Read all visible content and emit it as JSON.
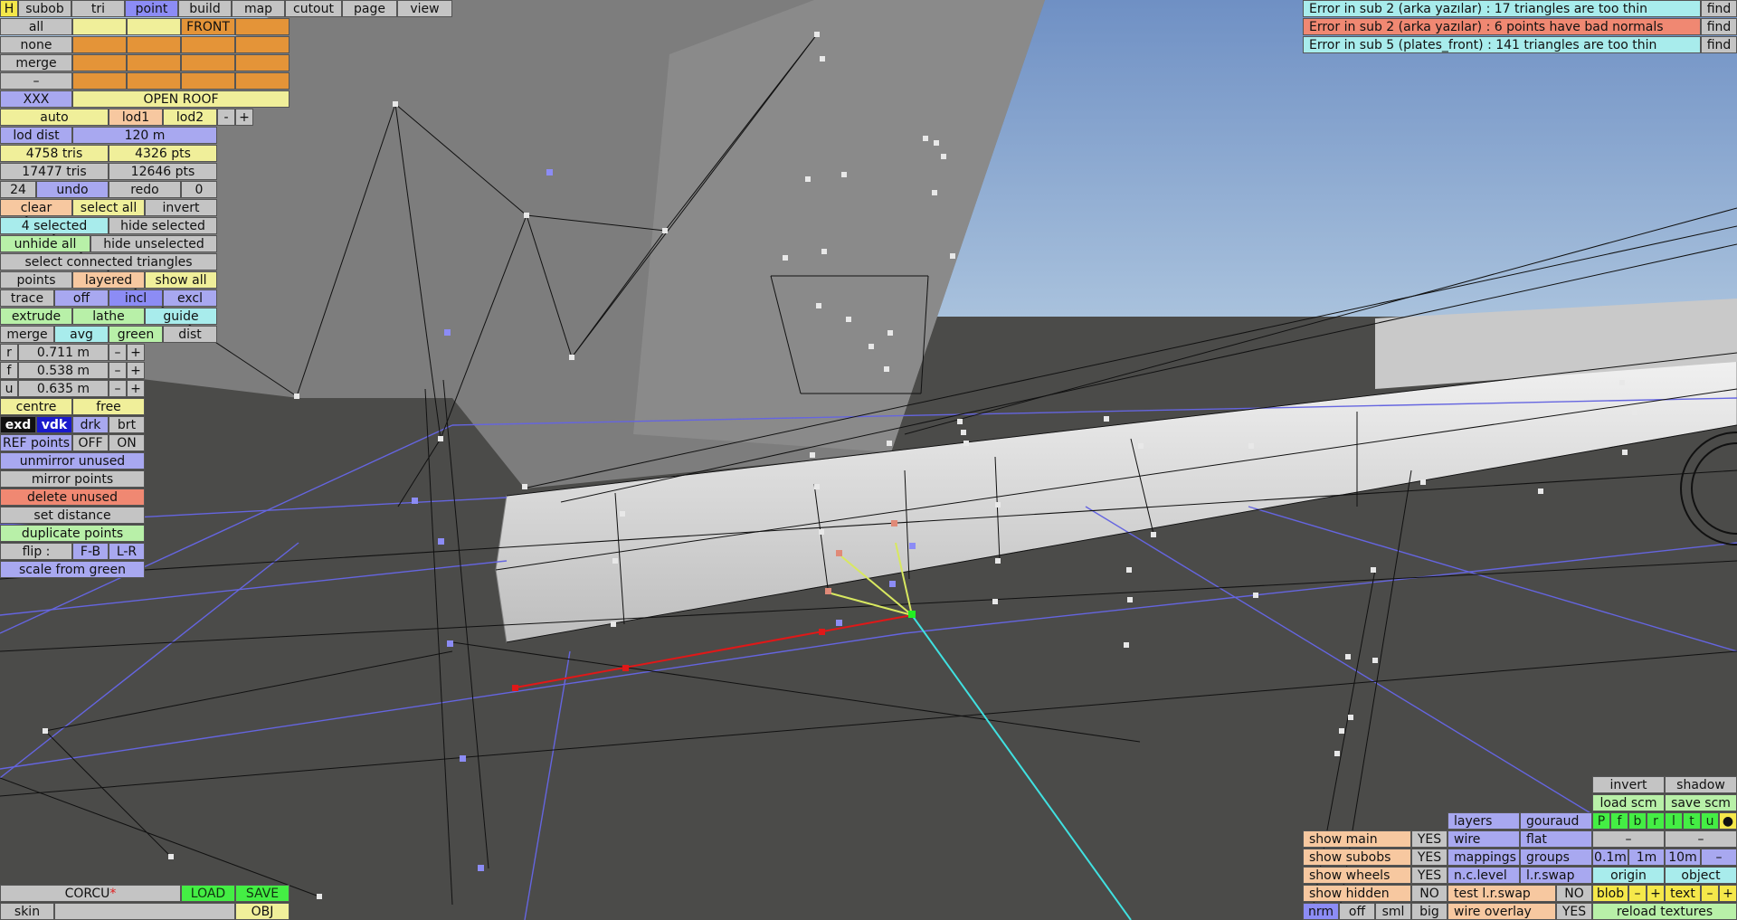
{
  "top_menu": [
    "H",
    "subob",
    "tri",
    "point",
    "build",
    "map",
    "cutout",
    "page",
    "view"
  ],
  "selection_rows": [
    "all",
    "none",
    "merge",
    "–"
  ],
  "front_label": "FRONT",
  "xxx_label": "XXX",
  "open_roof_label": "OPEN ROOF",
  "lod": {
    "auto": "auto",
    "lod1": "lod1",
    "lod2": "lod2",
    "minus": "-",
    "plus": "+",
    "dist_label": "lod dist",
    "dist_value": "120 m"
  },
  "stats": {
    "tris_a": "4758 tris",
    "pts_a": "4326 pts",
    "tris_b": "17477 tris",
    "pts_b": "12646 pts"
  },
  "undo": {
    "count": "24",
    "undo": "undo",
    "redo": "redo",
    "redo_count": "0"
  },
  "actions": {
    "clear": "clear",
    "select_all": "select all",
    "invert": "invert",
    "selected": "4 selected",
    "hide_selected": "hide selected",
    "unhide_all": "unhide all",
    "hide_unselected": "hide unselected",
    "select_connected": "select connected triangles"
  },
  "points_row": {
    "points": "points",
    "layered": "layered",
    "show_all": "show all"
  },
  "trace_row": {
    "trace": "trace",
    "off": "off",
    "incl": "incl",
    "excl": "excl"
  },
  "tools_row": {
    "extrude": "extrude",
    "lathe": "lathe",
    "guide": "guide"
  },
  "merge_row": {
    "merge": "merge",
    "avg": "avg",
    "green": "green",
    "dist": "dist"
  },
  "params": [
    {
      "label": "r",
      "value": "0.711 m"
    },
    {
      "label": "f",
      "value": "0.538 m"
    },
    {
      "label": "u",
      "value": "0.635 m"
    }
  ],
  "pm": {
    "minus": "–",
    "plus": "+"
  },
  "centre_row": {
    "centre": "centre",
    "free": "free"
  },
  "shade_row": {
    "exd": "exd",
    "vdk": "vdk",
    "drk": "drk",
    "brt": "brt"
  },
  "ref_row": {
    "label": "REF points",
    "off": "OFF",
    "on": "ON"
  },
  "bottom_actions": {
    "unmirror": "unmirror unused",
    "mirror": "mirror points",
    "delete": "delete unused",
    "set_distance": "set distance",
    "duplicate": "duplicate points",
    "flip": "flip :",
    "fb": "F-B",
    "lr": "L-R",
    "scale": "scale from green"
  },
  "errors": [
    {
      "text": "Error in sub 2 (arka yazılar) : 17 triangles are too thin",
      "color": "#a8ecec",
      "find": "find"
    },
    {
      "text": "Error in sub 2 (arka yazılar) : 6 points have bad normals",
      "color": "#f08872",
      "find": "find"
    },
    {
      "text": "Error in sub 5 (plates_front) : 141 triangles are too thin",
      "color": "#a8ecec",
      "find": "find"
    }
  ],
  "file": {
    "name": "CORCU",
    "modified": "*",
    "load": "LOAD",
    "save": "SAVE",
    "skin": "skin",
    "obj": "OBJ"
  },
  "br": {
    "invert": "invert",
    "shadow": "shadow",
    "load_scm": "load scm",
    "save_scm": "save scm",
    "layers": "layers",
    "gouraud": "gouraud",
    "wire": "wire",
    "flat": "flat",
    "mappings": "mappings",
    "groups": "groups",
    "nc_level": "n.c.level",
    "lr_swap": "l.r.swap",
    "test_lr_swap": "test l.r.swap",
    "test_lr_swap_val": "NO",
    "wire_overlay": "wire overlay",
    "wire_overlay_val": "YES",
    "show_main": "show main",
    "show_main_val": "YES",
    "show_subobs": "show subobs",
    "show_subobs_val": "YES",
    "show_wheels": "show wheels",
    "show_wheels_val": "YES",
    "show_hidden": "show hidden",
    "show_hidden_val": "NO",
    "nrm": "nrm",
    "off": "off",
    "sml": "sml",
    "big": "big",
    "letters": [
      "P",
      "f",
      "b",
      "r",
      "l",
      "t",
      "u",
      "●"
    ],
    "dash": "–",
    "step_a": "0.1m",
    "step_b": "1m",
    "step_c": "10m",
    "step_minus": "–",
    "origin": "origin",
    "object": "object",
    "blob": "blob",
    "text": "text",
    "minus": "–",
    "plus": "+",
    "reload": "reload textures"
  },
  "colors": {
    "viewport_floor": "#4a4a48",
    "sky": "#7f9fcb",
    "selected_tab": "#8c8cf5",
    "error_red": "#f08872"
  }
}
